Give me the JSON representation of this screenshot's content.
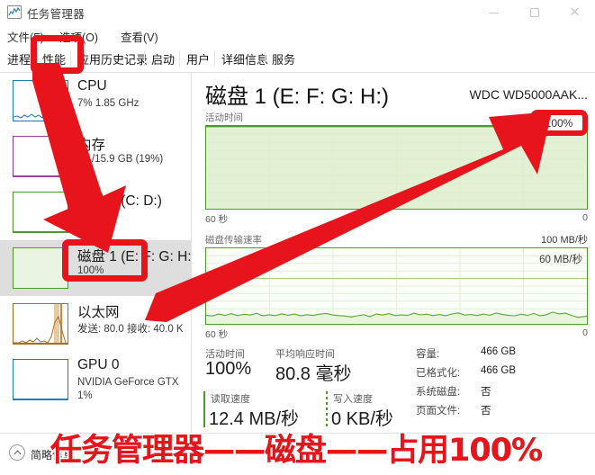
{
  "window": {
    "title": "任务管理器",
    "icon": "task-manager-icon",
    "minimize_label": "—",
    "maximize_label": "□",
    "close_label": "✕"
  },
  "menubar": {
    "items": [
      {
        "label": "文件(F)",
        "name": "menu-file"
      },
      {
        "label": "选项(O)",
        "name": "menu-options"
      },
      {
        "label": "查看(V)",
        "name": "menu-view"
      }
    ]
  },
  "tabs": [
    {
      "label": "进程",
      "name": "tab-processes",
      "selected": false
    },
    {
      "label": "性能",
      "name": "tab-performance",
      "selected": true
    },
    {
      "label": "应用历史记录",
      "name": "tab-app-history",
      "selected": false
    },
    {
      "label": "启动",
      "name": "tab-startup",
      "selected": false
    },
    {
      "label": "用户",
      "name": "tab-users",
      "selected": false
    },
    {
      "label": "详细信息",
      "name": "tab-details",
      "selected": false
    },
    {
      "label": "服务",
      "name": "tab-services",
      "selected": false
    }
  ],
  "sidebar": {
    "items": [
      {
        "title": "CPU",
        "sub": "7% 1.85 GHz",
        "sub2": "",
        "color": "#1c7cc4",
        "selected": false
      },
      {
        "title": "内存",
        "sub": "3.1/15.9 GB (19%)",
        "sub2": "",
        "color": "#9b3fa0",
        "selected": false
      },
      {
        "title": "磁盘 0 (C: D:)",
        "sub": "3%",
        "sub2": "",
        "color": "#4a9b27",
        "selected": false
      },
      {
        "title": "磁盘 1 (E: F: G: H:)",
        "sub": "100%",
        "sub2": "",
        "color": "#4a9b27",
        "selected": true
      },
      {
        "title": "以太网",
        "sub": "发送: 80.0 接收: 40.0 K",
        "sub2": "",
        "color": "#b06a1e",
        "selected": false
      },
      {
        "title": "GPU 0",
        "sub": "NVIDIA GeForce GTX",
        "sub2": "1%",
        "color": "#1c7cc4",
        "selected": false
      }
    ]
  },
  "main": {
    "title": "磁盘 1 (E: F: G: H:)",
    "model": "WDC WD5000AAK...",
    "chart1": {
      "label": "活动时间",
      "max_label": "100%",
      "left_axis": "60 秒",
      "right_axis": "0"
    },
    "chart2": {
      "label": "磁盘传输速率",
      "max_label": "100 MB/秒",
      "inner_note": "60 MB/秒",
      "left_axis": "60 秒",
      "right_axis": "0"
    },
    "stats": [
      {
        "caption": "活动时间",
        "value": "100%"
      },
      {
        "caption": "平均响应时间",
        "value": "80.8 毫秒"
      },
      {
        "caption": "读取速度",
        "value": "12.4 MB/秒"
      },
      {
        "caption": "写入速度",
        "value": "0 KB/秒"
      }
    ],
    "info": [
      {
        "key": "容量:",
        "value": "466 GB"
      },
      {
        "key": "已格式化:",
        "value": "466 GB"
      },
      {
        "key": "系统磁盘:",
        "value": "否"
      },
      {
        "key": "页面文件:",
        "value": "否"
      }
    ]
  },
  "statusbar": {
    "fewer_details": "简略信息",
    "chevron": "chevron-up-icon"
  },
  "annotation": {
    "caption": "任务管理器——磁盘——占用100%",
    "highlight_color": "#e8141c",
    "callout_value": "100%",
    "boxes": [
      "tab-performance",
      "sidebar-disk1",
      "chart-peak-100"
    ]
  },
  "chart_data": {
    "type": "area",
    "title": "磁盘 1 (E: F: G: H:) 活动时间 / 磁盘传输速率",
    "charts": [
      {
        "name": "活动时间",
        "ylabel": "活动时间",
        "ylim": [
          0,
          100
        ],
        "ymax_label": "100%",
        "xlabel_left": "60 秒",
        "xlabel_right": "0",
        "grid": true,
        "values": [
          100,
          100,
          100,
          100,
          100,
          100,
          100,
          100,
          100,
          100,
          100,
          100,
          100,
          100,
          100,
          100,
          100,
          100,
          100,
          100,
          100,
          100,
          100,
          100,
          100,
          100,
          100,
          100,
          100,
          100,
          100,
          100,
          100,
          100,
          100,
          100,
          100,
          100,
          100,
          100,
          100,
          100,
          100,
          100,
          100,
          100,
          100,
          100,
          100,
          100,
          100,
          100,
          100,
          100,
          100,
          100,
          100,
          100,
          100,
          100
        ]
      },
      {
        "name": "磁盘传输速率",
        "ylabel": "磁盘传输速率",
        "ylim": [
          0,
          100
        ],
        "ymax_label": "100 MB/秒",
        "annotation": "60 MB/秒",
        "xlabel_left": "60 秒",
        "xlabel_right": "0",
        "grid": true,
        "unit": "MB/秒",
        "values": [
          11,
          10,
          13,
          11,
          15,
          11,
          13,
          11,
          14,
          11,
          16,
          12,
          13,
          11,
          15,
          12,
          14,
          11,
          13,
          12,
          16,
          13,
          12,
          11,
          9,
          11,
          13,
          10,
          14,
          12,
          15,
          11,
          13,
          12,
          11,
          15,
          12,
          13,
          11,
          14,
          16,
          12,
          13,
          11,
          14,
          12,
          16,
          13,
          12,
          11,
          14,
          12,
          15,
          11,
          13,
          17,
          14,
          15,
          12,
          9
        ]
      }
    ]
  }
}
